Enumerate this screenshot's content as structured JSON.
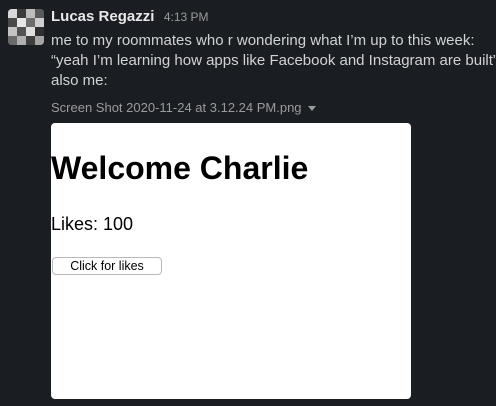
{
  "message": {
    "sender": "Lucas Regazzi",
    "timestamp": "4:13 PM",
    "lines": [
      "me to my roommates who r wondering what I’m up to this week:",
      "“yeah I’m learning how apps like Facebook and Instagram are built”",
      "also me:"
    ]
  },
  "attachment": {
    "filename": "Screen Shot 2020-11-24 at 3.12.24 PM.png",
    "dropdown_icon": "caret-down-icon"
  },
  "preview": {
    "heading": "Welcome Charlie",
    "likes": "Likes: 100",
    "button_label": "Click for likes"
  },
  "colors": {
    "background": "#1a1d21",
    "sender": "#e8e8e8",
    "text": "#d1d2d3",
    "muted": "#9a9b9d",
    "preview_bg": "#ffffff"
  }
}
